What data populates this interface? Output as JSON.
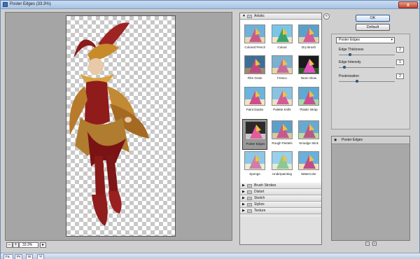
{
  "window": {
    "title": "Poster Edges (33.3%)",
    "close_label": "x"
  },
  "preview": {
    "zoom": "33.3%",
    "zoom_out": "–",
    "zoom_in": "+"
  },
  "gallery": {
    "category_open": "Artistic",
    "filters": [
      {
        "label": "Colored Pencil"
      },
      {
        "label": "Cutout"
      },
      {
        "label": "Dry Brush"
      },
      {
        "label": "Film Grain"
      },
      {
        "label": "Fresco"
      },
      {
        "label": "Neon Glow"
      },
      {
        "label": "Paint Daubs"
      },
      {
        "label": "Palette Knife"
      },
      {
        "label": "Plastic Wrap"
      },
      {
        "label": "Poster Edges"
      },
      {
        "label": "Rough Pastels"
      },
      {
        "label": "Smudge Stick"
      },
      {
        "label": "Sponge"
      },
      {
        "label": "Underpainting"
      },
      {
        "label": "Watercolor"
      }
    ],
    "selected_filter": "Poster Edges",
    "categories": [
      {
        "label": "Brush Strokes"
      },
      {
        "label": "Distort"
      },
      {
        "label": "Sketch"
      },
      {
        "label": "Stylize"
      },
      {
        "label": "Texture"
      }
    ]
  },
  "buttons": {
    "ok": "OK",
    "default": "Default"
  },
  "settings": {
    "filter_select": "Poster Edges",
    "params": [
      {
        "label": "Edge Thickness",
        "value": "2",
        "level": 0.2
      },
      {
        "label": "Edge Intensity",
        "value": "1",
        "level": 0.1
      },
      {
        "label": "Posterization",
        "value": "2",
        "level": 0.33
      }
    ]
  },
  "layers": {
    "items": [
      {
        "label": "Poster Edges"
      }
    ]
  },
  "taskbar": {
    "items": [
      "Fa..",
      "Ps",
      "W",
      "Y!"
    ]
  },
  "colors": {
    "accent": "#a9c3e3",
    "knob": "#3e6e9a"
  }
}
